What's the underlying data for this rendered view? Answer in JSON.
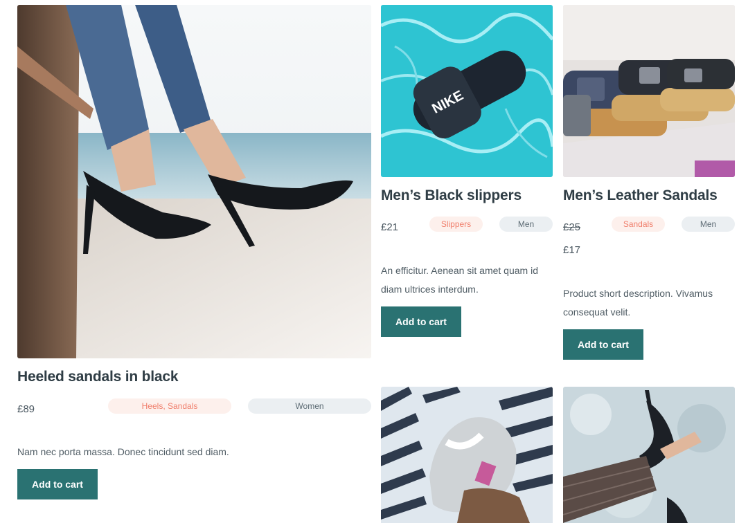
{
  "products": [
    {
      "title": "Heeled sandals in black",
      "price": "£89",
      "categories": "Heels, Sandals",
      "tag": "Women",
      "description": "Nam nec porta massa. Donec tincidunt sed diam.",
      "button": "Add to cart"
    },
    {
      "title": "Men’s Black slippers",
      "price": "£21",
      "categories": "Slippers",
      "tag": "Men",
      "description": "An efficitur. Aenean sit amet quam id diam ultrices interdum.",
      "button": "Add to cart"
    },
    {
      "title": "Men’s Leather Sandals",
      "price_old": "£25",
      "price": "£17",
      "categories": "Sandals",
      "tag": "Men",
      "description": "Product short description. Vivamus consequat velit.",
      "button": "Add to cart"
    }
  ],
  "colors": {
    "button": "#2a7272",
    "category_pill_bg": "#fdf0ec",
    "category_pill_text": "#f07e6b",
    "tag_pill_bg": "#ebeff2"
  }
}
